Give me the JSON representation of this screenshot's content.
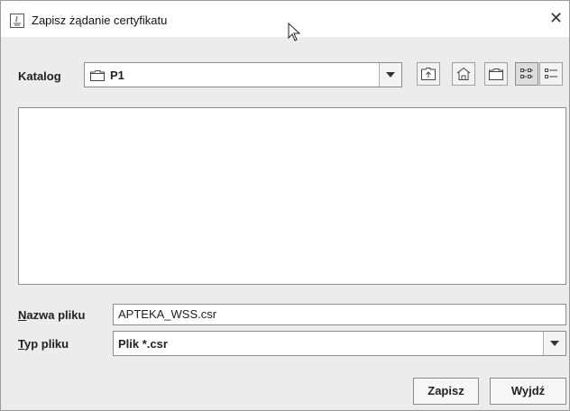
{
  "window": {
    "title": "Zapisz żądanie certyfikatu",
    "close_icon": "close-icon"
  },
  "location": {
    "label": "Katalog",
    "selected": "P1"
  },
  "toolbar": {
    "icons": [
      "up-folder-icon",
      "home-icon",
      "new-folder-icon",
      "list-view-icon",
      "details-view-icon"
    ]
  },
  "filename": {
    "label": "Nazwa pliku",
    "value": "APTEKA_WSS.csr"
  },
  "filetype": {
    "label": "Typ pliku",
    "selected": "Plik *.csr"
  },
  "buttons": {
    "save": "Zapisz",
    "cancel": "Wyjdź"
  }
}
